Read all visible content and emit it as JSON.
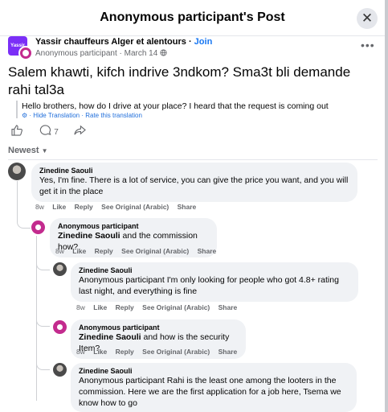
{
  "header": {
    "title": "Anonymous participant's Post",
    "close_icon": "✕"
  },
  "group": {
    "logo_text": "Yassir",
    "name": "Yassir chauffeurs Alger et alentours",
    "separator": " · ",
    "join_label": "Join",
    "author": "Anonymous participant",
    "date": "March 14",
    "privacy_icon": "globe-icon",
    "more_icon": "•••"
  },
  "post": {
    "text": "Salem khawti, kifch indrive 3ndkom? Sma3t bli demande rahi tal3a",
    "translation": "Hello brothers, how do I drive at your place? I heard that the request is coming out",
    "translation_links": "· Hide Translation · Rate this translation"
  },
  "actions": {
    "comment_count": "7"
  },
  "sort_label": "Newest",
  "comments": [
    {
      "author": "Zinedine Saouli",
      "text": "Yes, I'm fine. There is a lot of service, you can give the price you want, and you will get it in the place",
      "time": "8w",
      "like": "Like",
      "reply": "Reply",
      "see_original": "See Original (Arabic)",
      "share": "Share"
    },
    {
      "author": "Anonymous participant",
      "mention": "Zinedine Saouli",
      "text": " and the commission how?",
      "time": "8w",
      "like": "Like",
      "reply": "Reply",
      "see_original": "See Original (Arabic)",
      "share": "Share"
    },
    {
      "author": "Zinedine Saouli",
      "text": "Anonymous participant I'm only looking for people who got 4.8+ rating last night, and everything is fine",
      "time": "8w",
      "like": "Like",
      "reply": "Reply",
      "see_original": "See Original (Arabic)",
      "share": "Share"
    },
    {
      "author": "Anonymous participant",
      "mention": "Zinedine Saouli",
      "text": " and how is the security Item?",
      "time": "8w",
      "like": "Like",
      "reply": "Reply",
      "see_original": "See Original (Arabic)",
      "share": "Share"
    },
    {
      "author": "Zinedine Saouli",
      "text": "Anonymous participant Rahi is the least one among the looters in the commission. Here we are the first application for a job here, Tsema we know how to go"
    }
  ]
}
